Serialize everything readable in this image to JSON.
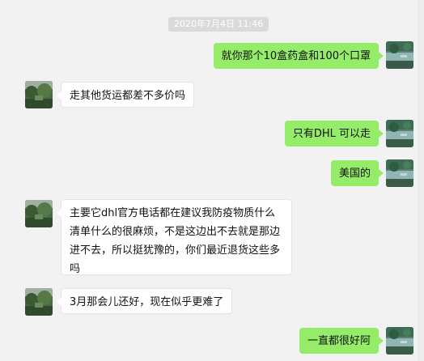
{
  "timestamp": "2020年7月4日 11:46",
  "messages": [
    {
      "side": "out",
      "text": "就你那个10盒药盒和100个口罩"
    },
    {
      "side": "in",
      "text": "走其他货运都差不多价吗"
    },
    {
      "side": "out",
      "text": "只有DHL 可以走"
    },
    {
      "side": "out",
      "text": "美国的"
    },
    {
      "side": "in",
      "text": "主要它dhl官方电话都在建议我防疫物质什么清单什么的很麻烦，不是这边出不去就是那边进不去，所以挺犹豫的，你们最近退货这些多吗"
    },
    {
      "side": "in",
      "text": "3月那会儿还好，现在似乎更难了"
    },
    {
      "side": "out",
      "text": "一直都很好阿"
    }
  ],
  "colors": {
    "background": "#f2f2f2",
    "outgoing_bubble": "#95ec69",
    "incoming_bubble": "#ffffff",
    "timestamp_chip": "#dadada"
  },
  "icons": {
    "contact_avatar": "landscape-photo-avatar",
    "self_avatar": "lake-photo-avatar"
  }
}
